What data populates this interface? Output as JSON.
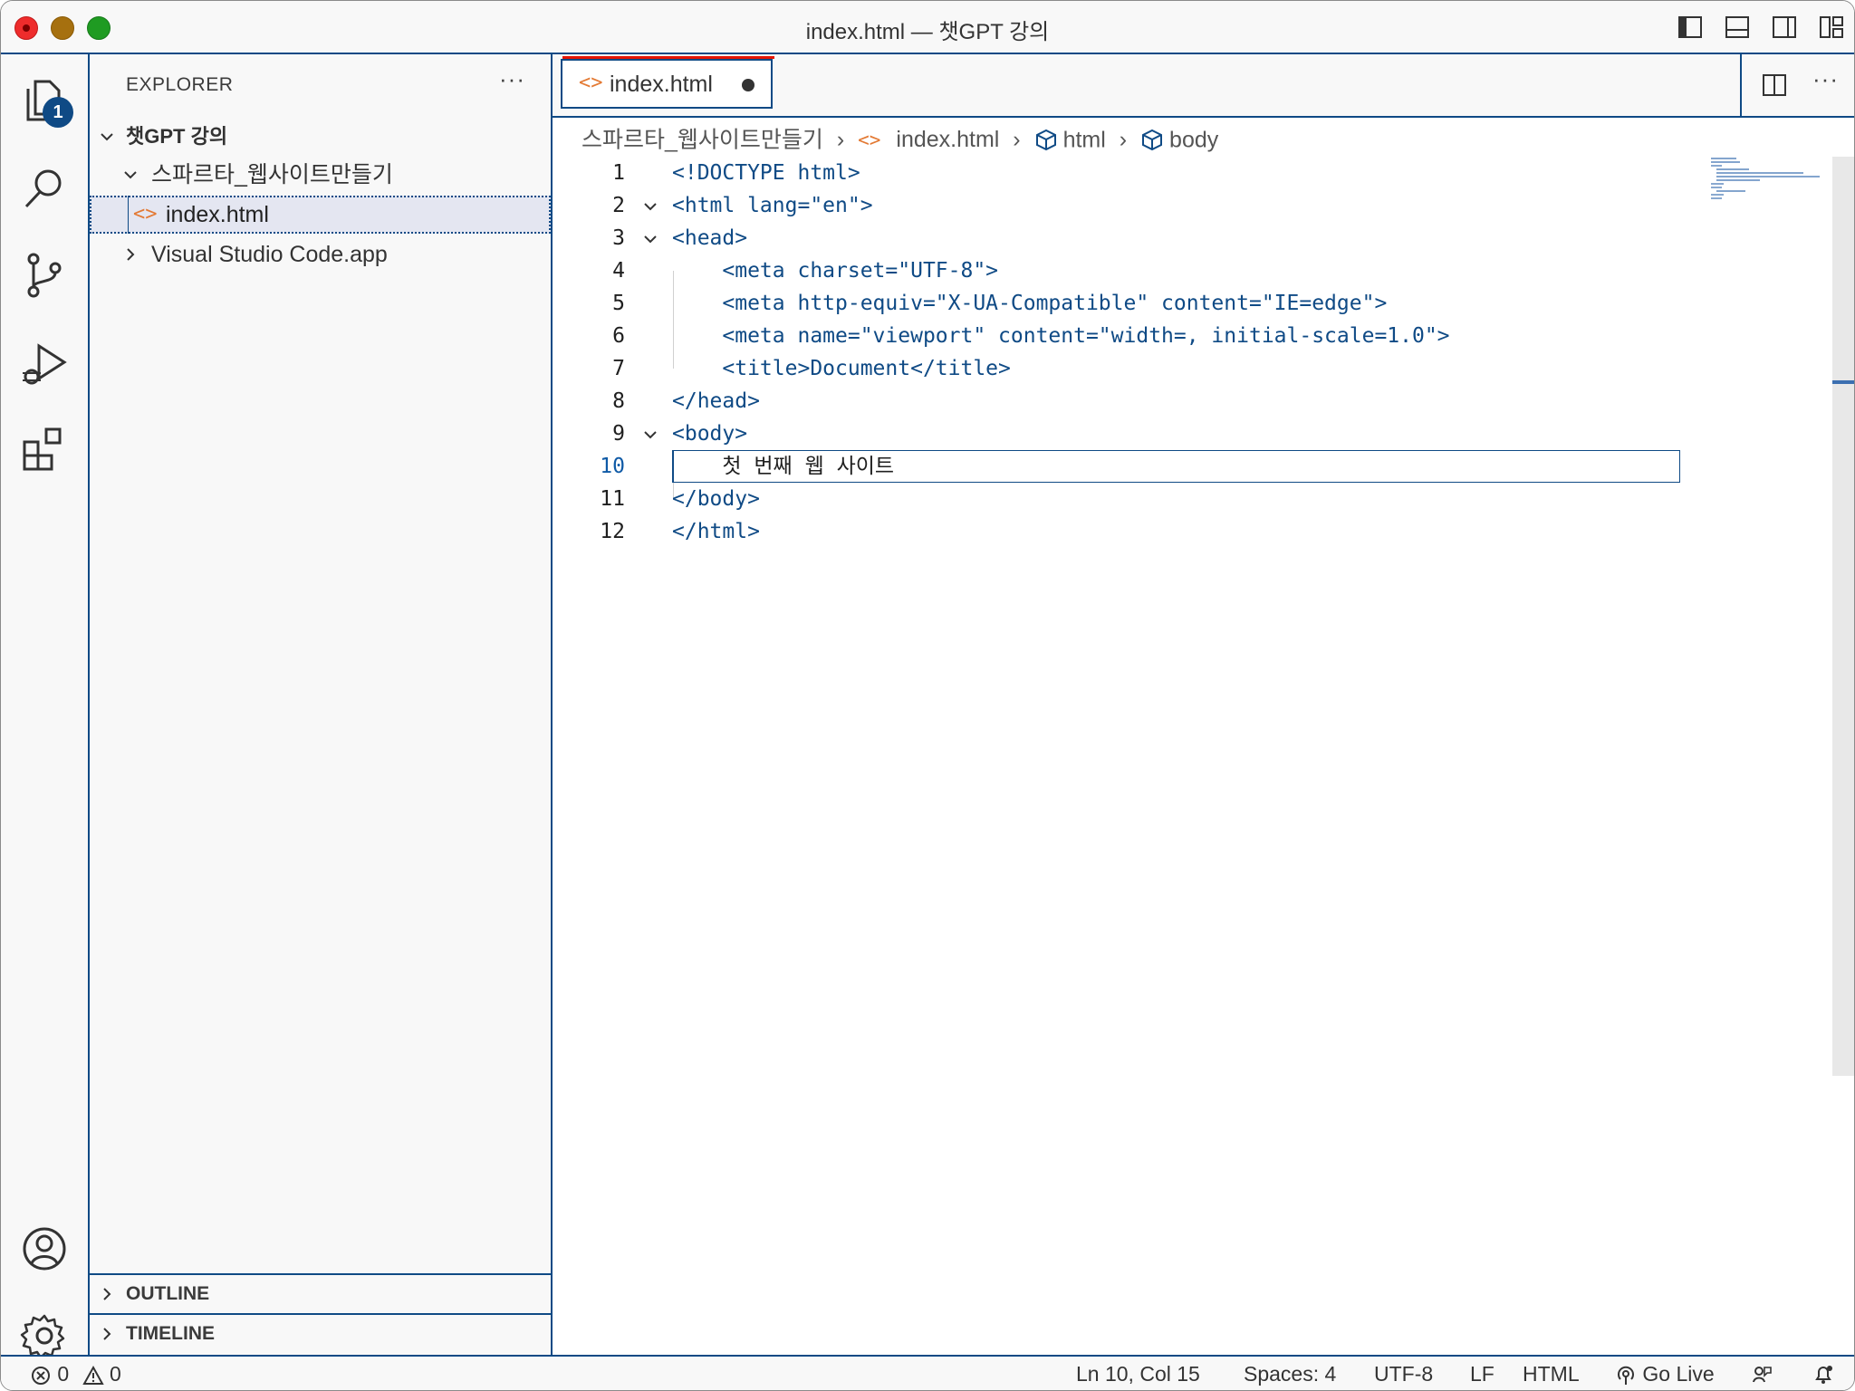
{
  "window": {
    "title": "index.html — 챗GPT 강의"
  },
  "activity_bar": {
    "items": [
      "explorer-icon",
      "search-icon",
      "source-control-icon",
      "run-debug-icon",
      "extensions-icon"
    ],
    "explorer_badge": "1",
    "bottom_items": [
      "account-icon",
      "gear-icon"
    ]
  },
  "sidebar": {
    "title": "EXPLORER",
    "more": "···",
    "tree": {
      "root": "챗GPT 강의",
      "folder": "스파르타_웹사이트만들기",
      "file": "index.html",
      "file_icon": "<>",
      "app": "Visual Studio Code.app"
    },
    "sections": [
      "OUTLINE",
      "TIMELINE"
    ]
  },
  "editor": {
    "tab": {
      "icon": "<>",
      "label": "index.html"
    },
    "tab_actions_more": "···",
    "breadcrumbs": {
      "folder": "스파르타_웹사이트만들기",
      "file_icon": "<>",
      "file": "index.html",
      "node1": "html",
      "node2": "body"
    },
    "lines": [
      {
        "n": "1",
        "text": "<!DOCTYPE html>"
      },
      {
        "n": "2",
        "text": "<html lang=\"en\">"
      },
      {
        "n": "3",
        "text": "<head>"
      },
      {
        "n": "4",
        "text": "    <meta charset=\"UTF-8\">"
      },
      {
        "n": "5",
        "text": "    <meta http-equiv=\"X-UA-Compatible\" content=\"IE=edge\">"
      },
      {
        "n": "6",
        "text": "    <meta name=\"viewport\" content=\"width=, initial-scale=1.0\">"
      },
      {
        "n": "7",
        "text": "    <title>Document</title>"
      },
      {
        "n": "8",
        "text": "</head>"
      },
      {
        "n": "9",
        "text": "<body>"
      },
      {
        "n": "10",
        "text": "    첫 번째 웹 사이트"
      },
      {
        "n": "11",
        "text": "</body>"
      },
      {
        "n": "12",
        "text": "</html>"
      }
    ]
  },
  "status_bar": {
    "errors": "0",
    "warnings": "0",
    "position": "Ln 10, Col 15",
    "spaces": "Spaces: 4",
    "encoding": "UTF-8",
    "eol": "LF",
    "language": "HTML",
    "go_live": "Go Live"
  },
  "colors": {
    "accent": "#0f4a85",
    "html_icon": "#e37933"
  }
}
